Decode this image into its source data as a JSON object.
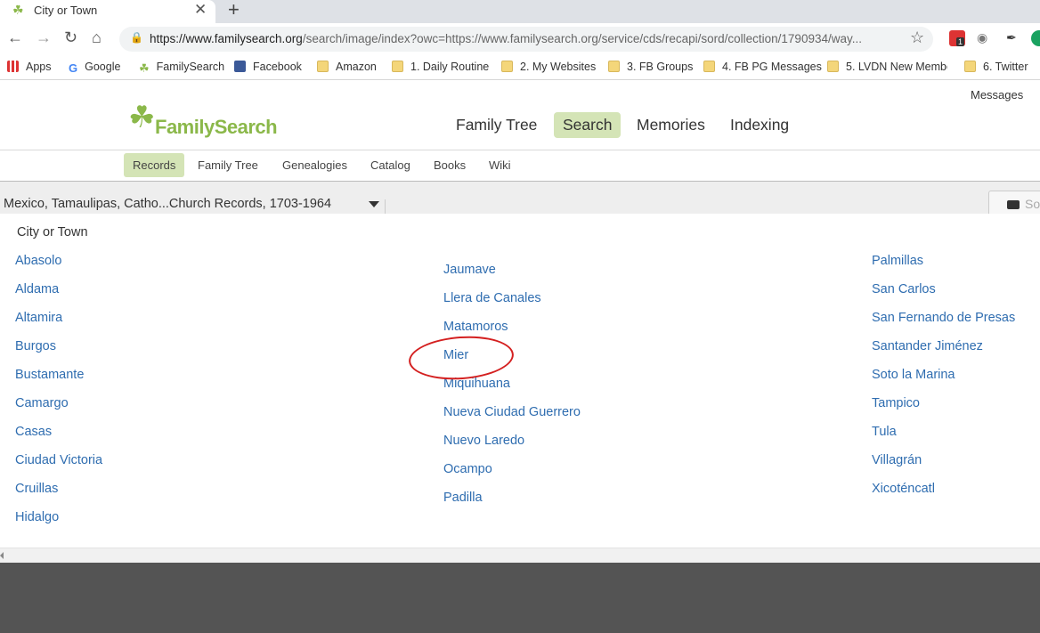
{
  "browser": {
    "tab_title": "City or Town",
    "url_domain": "https://www.familysearch.org",
    "url_path": "/search/image/index?owc=https://www.familysearch.org/service/cds/recapi/sord/collection/1790934/way...",
    "extension_badge": "1",
    "bookmarks": [
      {
        "label": "Apps",
        "icon": "apps-grid-icon"
      },
      {
        "label": "Google",
        "icon": "google-icon"
      },
      {
        "label": "FamilySearch",
        "icon": "familysearch-tree-icon"
      },
      {
        "label": "Facebook",
        "icon": "facebook-icon"
      },
      {
        "label": "Amazon",
        "icon": "folder-icon"
      },
      {
        "label": "1. Daily Routine",
        "icon": "folder-icon"
      },
      {
        "label": "2. My Websites",
        "icon": "folder-icon"
      },
      {
        "label": "3. FB Groups",
        "icon": "folder-icon"
      },
      {
        "label": "4. FB PG Messages",
        "icon": "folder-icon"
      },
      {
        "label": "5. LVDN New Membe",
        "icon": "folder-icon"
      },
      {
        "label": "6. Twitter",
        "icon": "folder-icon"
      }
    ]
  },
  "site": {
    "messages": "Messages",
    "logo_text": "FamilySearch",
    "main_nav": [
      "Family Tree",
      "Search",
      "Memories",
      "Indexing"
    ],
    "active_main_nav": "Search",
    "sub_nav": [
      "Records",
      "Family Tree",
      "Genealogies",
      "Catalog",
      "Books",
      "Wiki"
    ],
    "active_sub_nav": "Records",
    "collection_title": "Mexico, Tamaulipas, Catho...Church Records, 1703-1964",
    "sort_label": "So"
  },
  "browse": {
    "section_title": "City or Town",
    "col1": [
      "Abasolo",
      "Aldama",
      "Altamira",
      "Burgos",
      "Bustamante",
      "Camargo",
      "Casas",
      "Ciudad Victoria",
      "Cruillas",
      "Hidalgo"
    ],
    "col2": [
      "Jaumave",
      "Llera de Canales",
      "Matamoros",
      "Mier",
      "Miquihuana",
      "Nueva Ciudad Guerrero",
      "Nuevo Laredo",
      "Ocampo",
      "Padilla"
    ],
    "col3": [
      "Palmillas",
      "San Carlos",
      "San Fernando de Presas",
      "Santander Jiménez",
      "Soto la Marina",
      "Tampico",
      "Tula",
      "Villagrán",
      "Xicoténcatl"
    ],
    "highlighted_town": "Mier",
    "annotation_color": "#d42020",
    "link_color": "#2f6db0",
    "accent_color": "#8bb84a"
  }
}
